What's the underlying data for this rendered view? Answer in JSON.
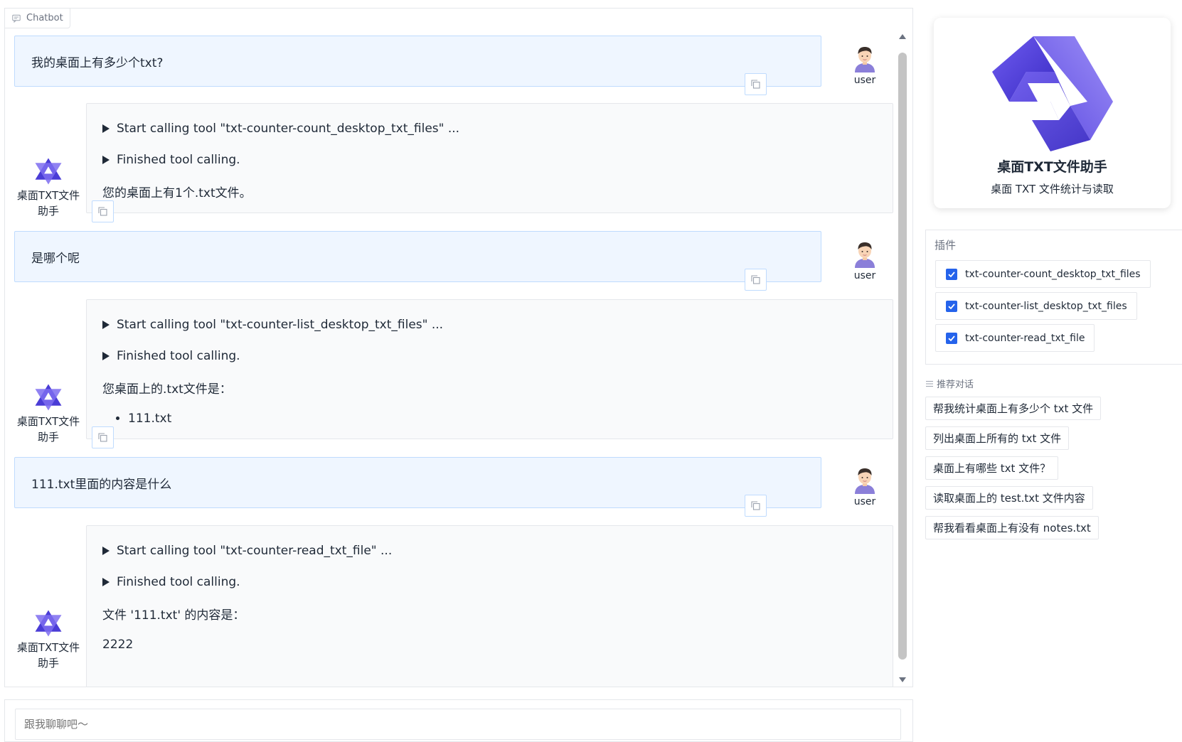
{
  "chatbot": {
    "label": "Chatbot",
    "input_placeholder": "跟我聊聊吧～"
  },
  "user": {
    "name": "user"
  },
  "bot": {
    "name_line1": "桌面TXT文件",
    "name_line2": "助手"
  },
  "messages": [
    {
      "role": "user",
      "text": "我的桌面上有多少个txt?"
    },
    {
      "role": "bot",
      "tool_start": "Start calling tool \"txt-counter-count_desktop_txt_files\" ...",
      "tool_end": "Finished tool calling.",
      "text": "您的桌面上有1个.txt文件。"
    },
    {
      "role": "user",
      "text": "是哪个呢"
    },
    {
      "role": "bot",
      "tool_start": "Start calling tool \"txt-counter-list_desktop_txt_files\" ...",
      "tool_end": "Finished tool calling.",
      "text": "您桌面上的.txt文件是：",
      "list": [
        "111.txt"
      ]
    },
    {
      "role": "user",
      "text": "111.txt里面的内容是什么"
    },
    {
      "role": "bot",
      "tool_start": "Start calling tool \"txt-counter-read_txt_file\" ...",
      "tool_end": "Finished tool calling.",
      "text": "文件 '111.txt' 的内容是：",
      "text2": "2222"
    }
  ],
  "agent": {
    "name": "桌面TXT文件助手",
    "description": "桌面 TXT 文件统计与读取"
  },
  "plugins": {
    "title": "插件",
    "items": [
      {
        "label": "txt-counter-count_desktop_txt_files",
        "checked": true
      },
      {
        "label": "txt-counter-list_desktop_txt_files",
        "checked": true
      },
      {
        "label": "txt-counter-read_txt_file",
        "checked": true
      }
    ]
  },
  "suggestions": {
    "title": "推荐对话",
    "items": [
      "帮我统计桌面上有多少个 txt 文件",
      "列出桌面上所有的 txt 文件",
      "桌面上有哪些 txt 文件？",
      "读取桌面上的 test.txt 文件内容",
      "帮我看看桌面上有没有 notes.txt"
    ]
  },
  "colors": {
    "accent": "#2563eb",
    "user_bubble": "#eff6ff",
    "bot_bubble": "#f9fafb",
    "logo_dark": "#3b2fc9",
    "logo_light": "#7c6cf0"
  },
  "icons": {
    "chatbot": "chat-icon",
    "copy": "copy-icon",
    "user_avatar": "user-avatar-icon",
    "bot_avatar": "qwen-logo-icon",
    "checkbox": "check-icon",
    "suggestions": "list-icon"
  }
}
